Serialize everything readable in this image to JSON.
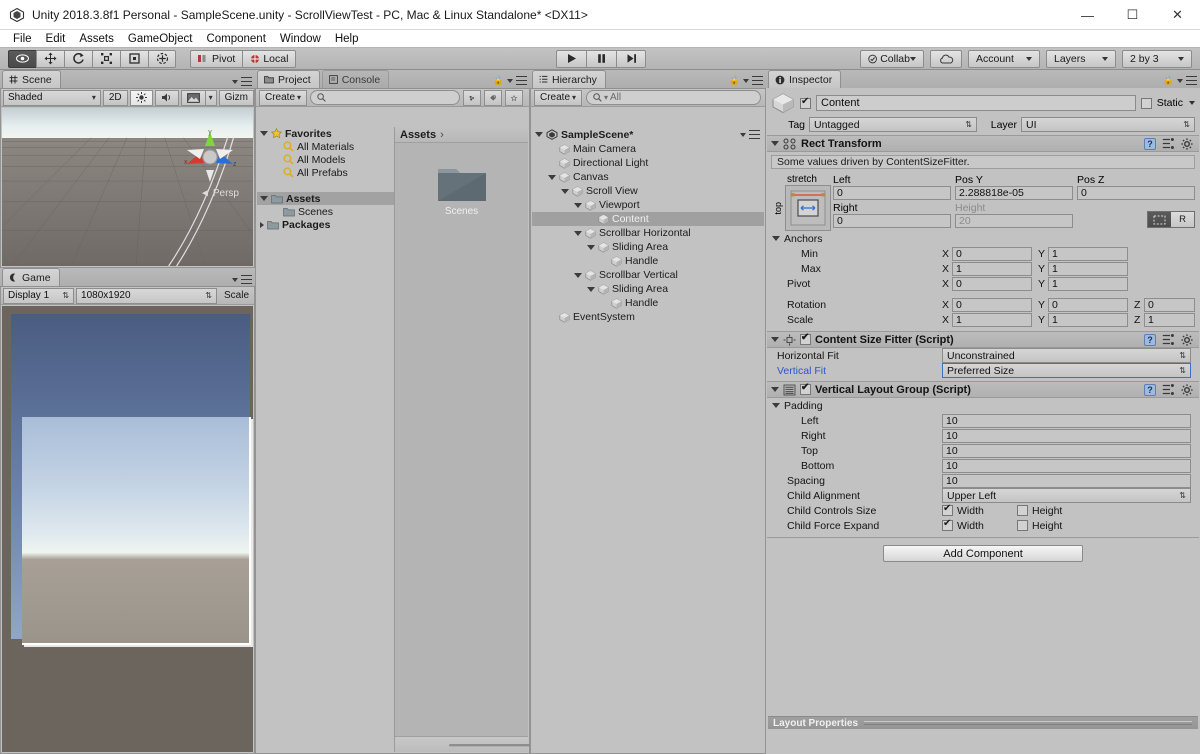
{
  "window": {
    "title": "Unity 2018.3.8f1 Personal - SampleScene.unity - ScrollViewTest - PC, Mac & Linux Standalone* <DX11>",
    "minimize": "—",
    "maximize": "☐",
    "close": "✕"
  },
  "menubar": {
    "items": [
      "File",
      "Edit",
      "Assets",
      "GameObject",
      "Component",
      "Window",
      "Help"
    ]
  },
  "toolbar": {
    "tools": [
      "hand-tool",
      "move-tool",
      "rotate-tool",
      "scale-tool",
      "rect-tool",
      "transform-tool"
    ],
    "pivot_label": "Pivot",
    "local_label": "Local",
    "play_label": "▶",
    "pause_label": "❚❚",
    "step_label": "▶❘",
    "collab_label": "Collab",
    "cloud_label": "cloud-icon",
    "account_label": "Account",
    "layers_label": "Layers",
    "layout_label": "2 by 3"
  },
  "scene": {
    "tab_label": "Scene",
    "shading_mode": "Shaded",
    "btn_2d": "2D",
    "btn_light": "light-icon",
    "btn_audio": "audio-icon",
    "btn_fx": "fx-icon",
    "btn_gizmos": "Gizm",
    "persp_label": "Persp",
    "axis_x": "x",
    "axis_y": "y",
    "axis_z": "z"
  },
  "game": {
    "tab_label": "Game",
    "display": "Display 1",
    "resolution": "1080x1920",
    "scale_label": "Scale"
  },
  "project": {
    "tab_label": "Project",
    "console_tab_label": "Console",
    "create_label": "Create",
    "search_placeholder": "",
    "tree": [
      {
        "label": "Favorites",
        "indent": 0,
        "icon": "star-icon",
        "arrow": "open",
        "bold": true
      },
      {
        "label": "All Materials",
        "indent": 1,
        "icon": "search-icon",
        "arrow": "none",
        "bold": false
      },
      {
        "label": "All Models",
        "indent": 1,
        "icon": "search-icon",
        "arrow": "none",
        "bold": false
      },
      {
        "label": "All Prefabs",
        "indent": 1,
        "icon": "search-icon",
        "arrow": "none",
        "bold": false
      },
      {
        "label": "",
        "indent": 0,
        "icon": "none",
        "arrow": "none",
        "bold": false
      },
      {
        "label": "Assets",
        "indent": 0,
        "icon": "folder-icon",
        "arrow": "open",
        "bold": true,
        "selected": true
      },
      {
        "label": "Scenes",
        "indent": 1,
        "icon": "folder-icon",
        "arrow": "none",
        "bold": false
      },
      {
        "label": "Packages",
        "indent": 0,
        "icon": "folder-icon",
        "arrow": "closed",
        "bold": true
      }
    ],
    "breadcrumb": "Assets",
    "breadcrumb_sep": "›",
    "items": [
      {
        "label": "Scenes",
        "icon": "folder-icon"
      }
    ]
  },
  "hierarchy": {
    "tab_label": "Hierarchy",
    "create_label": "Create",
    "search_placeholder": "All",
    "scene_name": "SampleScene*",
    "nodes": [
      {
        "label": "Main Camera",
        "indent": 1,
        "arrow": "none"
      },
      {
        "label": "Directional Light",
        "indent": 1,
        "arrow": "none"
      },
      {
        "label": "Canvas",
        "indent": 1,
        "arrow": "open"
      },
      {
        "label": "Scroll View",
        "indent": 2,
        "arrow": "open"
      },
      {
        "label": "Viewport",
        "indent": 3,
        "arrow": "open"
      },
      {
        "label": "Content",
        "indent": 4,
        "arrow": "none",
        "selected": true
      },
      {
        "label": "Scrollbar Horizontal",
        "indent": 3,
        "arrow": "open"
      },
      {
        "label": "Sliding Area",
        "indent": 4,
        "arrow": "open"
      },
      {
        "label": "Handle",
        "indent": 5,
        "arrow": "none"
      },
      {
        "label": "Scrollbar Vertical",
        "indent": 3,
        "arrow": "open"
      },
      {
        "label": "Sliding Area",
        "indent": 4,
        "arrow": "open"
      },
      {
        "label": "Handle",
        "indent": 5,
        "arrow": "none"
      },
      {
        "label": "EventSystem",
        "indent": 1,
        "arrow": "none"
      }
    ]
  },
  "inspector": {
    "tab_label": "Inspector",
    "object_name": "Content",
    "object_enabled": true,
    "static_label": "Static",
    "tag_label": "Tag",
    "tag_value": "Untagged",
    "layer_label": "Layer",
    "layer_value": "UI",
    "rect_transform": {
      "title": "Rect Transform",
      "info": "Some values driven by ContentSizeFitter.",
      "anchor_preset_top": "top",
      "anchor_preset_stretch": "stretch",
      "raw_button": "R",
      "left_label": "Left",
      "left_value": "0",
      "posy_label": "Pos Y",
      "posy_value": "2.288818e-05",
      "posz_label": "Pos Z",
      "posz_value": "0",
      "right_label": "Right",
      "right_value": "0",
      "height_label": "Height",
      "height_value": "20",
      "anchors_label": "Anchors",
      "min_label": "Min",
      "min_x": "0",
      "min_y": "1",
      "max_label": "Max",
      "max_x": "1",
      "max_y": "1",
      "pivot_label": "Pivot",
      "pivot_x": "0",
      "pivot_y": "1",
      "rotation_label": "Rotation",
      "rot_x": "0",
      "rot_y": "0",
      "rot_z": "0",
      "scale_label": "Scale",
      "scale_x": "1",
      "scale_y": "1",
      "scale_z": "1",
      "axis_x": "X",
      "axis_y": "Y",
      "axis_z": "Z"
    },
    "content_size_fitter": {
      "title": "Content Size Fitter (Script)",
      "enabled": true,
      "horizontal_fit_label": "Horizontal Fit",
      "horizontal_fit_value": "Unconstrained",
      "vertical_fit_label": "Vertical Fit",
      "vertical_fit_value": "Preferred Size"
    },
    "vertical_layout_group": {
      "title": "Vertical Layout Group (Script)",
      "enabled": true,
      "padding_label": "Padding",
      "left_label": "Left",
      "left_value": "10",
      "right_label": "Right",
      "right_value": "10",
      "top_label": "Top",
      "top_value": "10",
      "bottom_label": "Bottom",
      "bottom_value": "10",
      "spacing_label": "Spacing",
      "spacing_value": "10",
      "child_alignment_label": "Child Alignment",
      "child_alignment_value": "Upper Left",
      "child_controls_size_label": "Child Controls Size",
      "child_force_expand_label": "Child Force Expand",
      "width_label": "Width",
      "height_label": "Height",
      "controls_width": true,
      "controls_height": false,
      "expand_width": true,
      "expand_height": false
    },
    "add_component_label": "Add Component",
    "layout_properties_label": "Layout Properties"
  },
  "colors": {
    "panel_bg": "#c2c2c2",
    "chrome": "#b4b4b4",
    "selection": "#a0a0a0",
    "link_blue": "#2b57c9",
    "highlight_border": "#3d6fd0"
  }
}
